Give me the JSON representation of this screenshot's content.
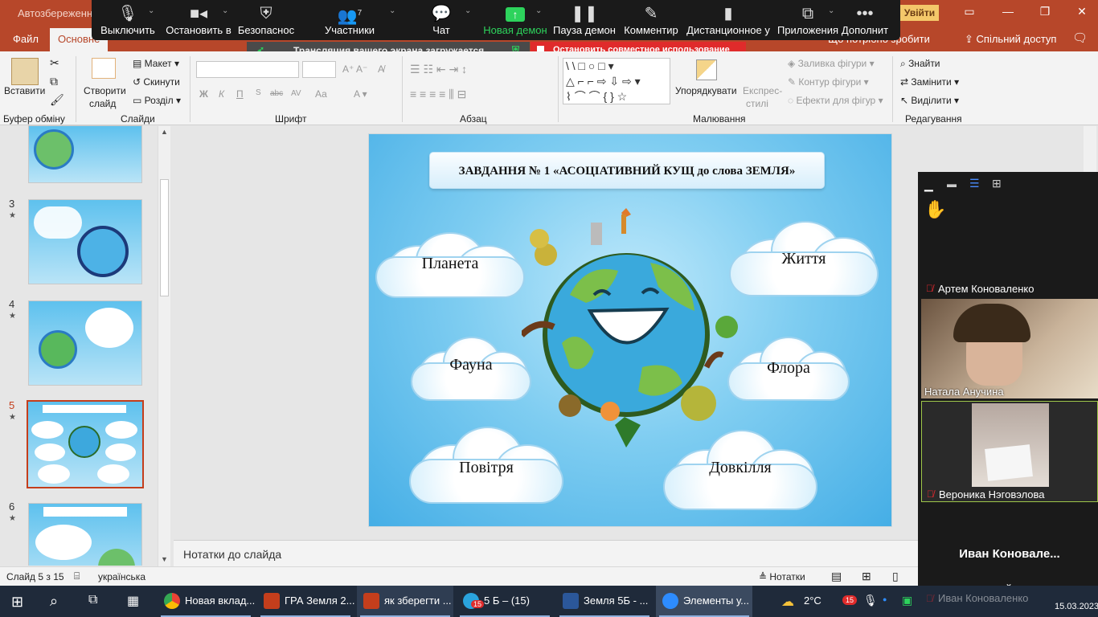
{
  "titlebar": {
    "autosave": "Автозбереження",
    "signin": "Увійти"
  },
  "tabs": {
    "file": "Файл",
    "home": "Основне",
    "tell_me": "Що потрібно зробити",
    "share": "Спільний доступ"
  },
  "zoom_bar": {
    "items": [
      {
        "label": "Выключить",
        "icon": "microphone-icon"
      },
      {
        "label": "Остановить в",
        "icon": "video-camera-icon"
      },
      {
        "label": "Безопаснос",
        "icon": "shield-icon"
      },
      {
        "label": "Участники",
        "icon": "participants-icon",
        "count": "7"
      },
      {
        "label": "Чат",
        "icon": "chat-icon"
      },
      {
        "label": "Новая демон",
        "icon": "share-screen-icon"
      },
      {
        "label": "Пауза демон",
        "icon": "pause-icon"
      },
      {
        "label": "Комментир",
        "icon": "pen-icon"
      },
      {
        "label": "Дистанционное у",
        "icon": "mouse-icon"
      },
      {
        "label": "Приложения",
        "icon": "apps-icon"
      },
      {
        "label": "Дополнит",
        "icon": "more-icon"
      }
    ],
    "share_status": "Трансляция вашего экрана загружается",
    "stop_share": "Остановить совместное использование"
  },
  "ribbon": {
    "clipboard": {
      "paste": "Вставити",
      "label": "Буфер обміну"
    },
    "slides": {
      "new_slide_1": "Створити",
      "new_slide_2": "слайд",
      "layout": "Макет",
      "reset": "Скинути",
      "section": "Розділ",
      "label": "Слайди"
    },
    "font": {
      "bold": "Ж",
      "italic": "К",
      "underline": "П",
      "strike": "abc",
      "spacing": "AV",
      "case": "Аа",
      "label": "Шрифт"
    },
    "paragraph": {
      "label": "Абзац"
    },
    "drawing": {
      "arrange": "Упорядкувати",
      "quick_styles_1": "Експрес-",
      "quick_styles_2": "стилі",
      "fill": "Заливка фігури",
      "outline": "Контур фігури",
      "effects": "Ефекти для фігур",
      "label": "Малювання"
    },
    "editing": {
      "find": "Знайти",
      "replace": "Замінити",
      "select": "Виділити",
      "label": "Редагування"
    }
  },
  "thumbnails": [
    {
      "num": "3",
      "selected": false
    },
    {
      "num": "4",
      "selected": false
    },
    {
      "num": "5",
      "selected": true
    },
    {
      "num": "6",
      "selected": false
    }
  ],
  "slide": {
    "title": "ЗАВДАННЯ № 1 «АСОЦІАТИВНИЙ КУЩ до слова ЗЕМЛЯ»",
    "clouds": [
      "Планета",
      "Життя",
      "Фауна",
      "Флора",
      "Повітря",
      "Довкілля"
    ]
  },
  "notes_placeholder": "Нотатки до слайда",
  "status": {
    "slide_of": "Слайд 5 з 15",
    "language": "українська",
    "notes": "Нотатки"
  },
  "zoom_panel": {
    "participants": [
      {
        "name": "Артем Коноваленко",
        "muted": true
      },
      {
        "name": "Натала Анучина",
        "muted": false
      },
      {
        "name": "Вероника Нэговэлова",
        "muted": true
      },
      {
        "name": "Иван  Коновале...",
        "muted": false
      },
      {
        "name": "Иван Коноваленко",
        "muted": true
      }
    ]
  },
  "taskbar": {
    "items": [
      {
        "label": "Новая вклад...",
        "color": "#4285f4"
      },
      {
        "label": "ГРА Земля 2...",
        "color": "#c43e1c"
      },
      {
        "label": "як зберегти ...",
        "color": "#c43e1c"
      },
      {
        "label": "5 Б – (15)",
        "color": "#2aa3dd",
        "badge": "15"
      },
      {
        "label": "Земля 5Б - ...",
        "color": "#2b579a"
      },
      {
        "label": "Элементы у...",
        "color": "#2d8cff"
      }
    ],
    "weather": "2°C",
    "date": "15.03.2023",
    "badge": "15"
  },
  "colors": {
    "powerpoint_accent": "#b7472a",
    "zoom_bar": "#1a1a1a",
    "stop_share": "#e02b2b",
    "share_green": "#2dd35c",
    "taskbar": "#1f2a3a"
  }
}
